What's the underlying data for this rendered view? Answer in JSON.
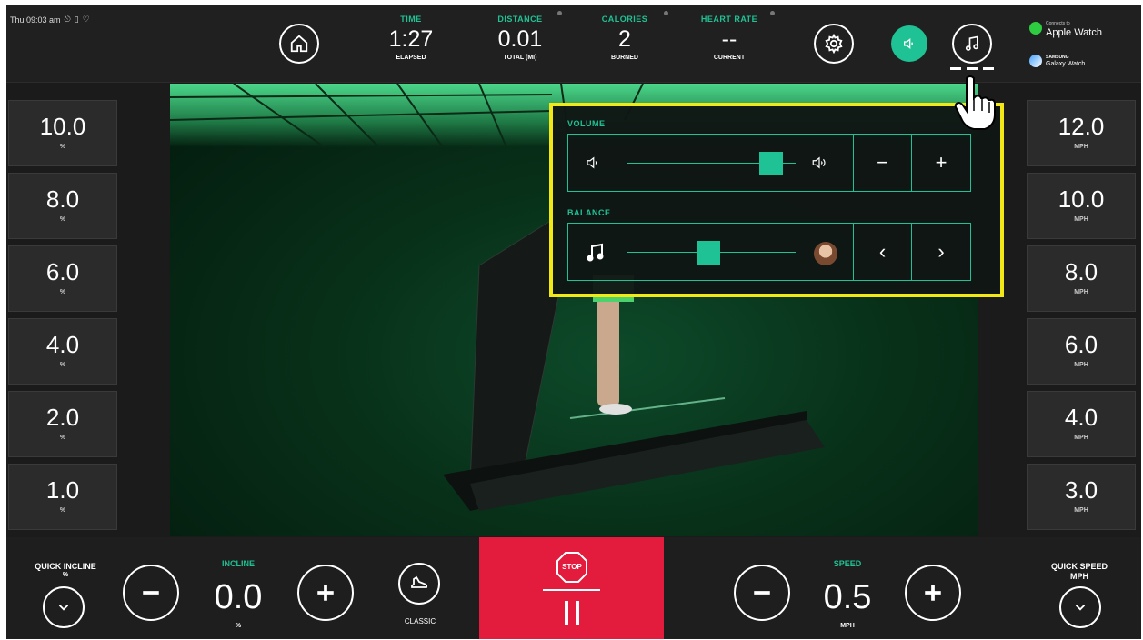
{
  "status": {
    "time": "Thu 09:03 am"
  },
  "metrics": [
    {
      "label": "TIME",
      "value": "1:27",
      "sub": "ELAPSED"
    },
    {
      "label": "DISTANCE",
      "value": "0.01",
      "sub": "TOTAL (MI)"
    },
    {
      "label": "CALORIES",
      "value": "2",
      "sub": "BURNED"
    },
    {
      "label": "HEART RATE",
      "value": "--",
      "sub": "CURRENT"
    }
  ],
  "watches": {
    "apple_top": "Connects to",
    "apple": "Apple Watch",
    "samsung_top": "SAMSUNG",
    "samsung": "Galaxy Watch"
  },
  "incline_presets": {
    "unit": "%",
    "values": [
      "10.0",
      "8.0",
      "6.0",
      "4.0",
      "2.0",
      "1.0"
    ]
  },
  "speed_presets": {
    "unit": "MPH",
    "values": [
      "12.0",
      "10.0",
      "8.0",
      "6.0",
      "4.0",
      "3.0"
    ]
  },
  "panel": {
    "volume_label": "VOLUME",
    "balance_label": "BALANCE",
    "volume_level": 0.91,
    "balance_level": 0.48,
    "minus": "−",
    "plus": "+",
    "left": "‹",
    "right": "›"
  },
  "bottom": {
    "quick_incline": "QUICK INCLINE",
    "quick_incline_unit": "%",
    "incline_label": "INCLINE",
    "incline_value": "0.0",
    "incline_unit": "%",
    "mode": "CLASSIC",
    "stop": "STOP",
    "speed_label": "SPEED",
    "speed_value": "0.5",
    "speed_unit": "MPH",
    "quick_speed": "QUICK SPEED",
    "quick_speed_unit": "MPH"
  },
  "colors": {
    "accent": "#1fc294",
    "stop": "#e31b3c",
    "highlight": "#f2e815"
  },
  "icons": [
    "home-icon",
    "settings-icon",
    "speaker-icon",
    "music-note-icon",
    "stop-sign-icon",
    "pause-icon",
    "minus-icon",
    "plus-icon",
    "chevron-down-icon",
    "shoe-icon"
  ]
}
